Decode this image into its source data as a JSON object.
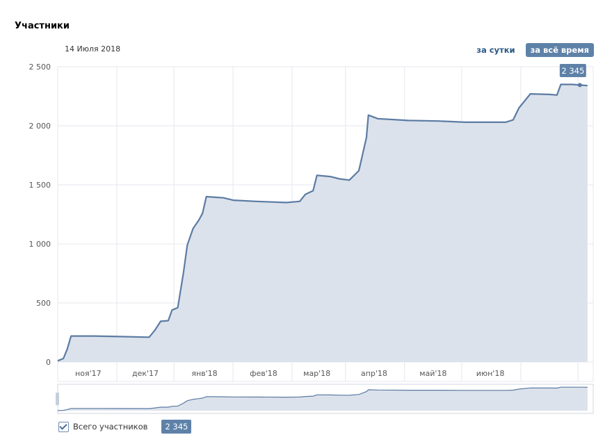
{
  "header": {
    "title": "Участники"
  },
  "hover_date": "14 Июля 2018",
  "range": {
    "day_label": "за сутки",
    "all_label": "за всё время",
    "active": "all"
  },
  "legend": {
    "label": "Всего участников",
    "value": "2 345",
    "checked": true
  },
  "colors": {
    "line": "#5b7ba3",
    "fill": "#dce2eb",
    "badge": "#5e81a8",
    "grid": "#e4e7ec"
  },
  "chart_data": {
    "type": "area",
    "title": "Участники",
    "xlabel": "",
    "ylabel": "",
    "ylim": [
      0,
      2500
    ],
    "y_ticks": [
      "0",
      "500",
      "1 000",
      "1 500",
      "2 000",
      "2 500"
    ],
    "x_ticks": [
      "ноя'17",
      "дек'17",
      "янв'18",
      "фев'18",
      "мар'18",
      "апр'18",
      "май'18",
      "июн'18"
    ],
    "x_domain": [
      "2017-10-13",
      "2017-07-21"
    ],
    "series": [
      {
        "name": "Всего участников",
        "points": [
          [
            "2017-10-13",
            10
          ],
          [
            "2017-10-16",
            30
          ],
          [
            "2017-10-18",
            110
          ],
          [
            "2017-10-20",
            220
          ],
          [
            "2017-11-01",
            220
          ],
          [
            "2017-11-15",
            215
          ],
          [
            "2017-11-30",
            210
          ],
          [
            "2017-12-03",
            270
          ],
          [
            "2017-12-06",
            345
          ],
          [
            "2017-12-10",
            350
          ],
          [
            "2017-12-12",
            440
          ],
          [
            "2017-12-15",
            460
          ],
          [
            "2017-12-18",
            760
          ],
          [
            "2017-12-20",
            990
          ],
          [
            "2017-12-23",
            1130
          ],
          [
            "2017-12-26",
            1200
          ],
          [
            "2017-12-28",
            1260
          ],
          [
            "2017-12-30",
            1400
          ],
          [
            "2018-01-08",
            1390
          ],
          [
            "2018-01-13",
            1370
          ],
          [
            "2018-01-25",
            1360
          ],
          [
            "2018-02-10",
            1350
          ],
          [
            "2018-02-17",
            1360
          ],
          [
            "2018-02-20",
            1420
          ],
          [
            "2018-02-24",
            1450
          ],
          [
            "2018-02-26",
            1580
          ],
          [
            "2018-03-05",
            1570
          ],
          [
            "2018-03-10",
            1550
          ],
          [
            "2018-03-15",
            1540
          ],
          [
            "2018-03-20",
            1620
          ],
          [
            "2018-03-24",
            1900
          ],
          [
            "2018-03-25",
            2090
          ],
          [
            "2018-03-30",
            2060
          ],
          [
            "2018-04-15",
            2045
          ],
          [
            "2018-05-01",
            2040
          ],
          [
            "2018-05-15",
            2030
          ],
          [
            "2018-06-05",
            2030
          ],
          [
            "2018-06-09",
            2050
          ],
          [
            "2018-06-12",
            2150
          ],
          [
            "2018-06-18",
            2270
          ],
          [
            "2018-06-28",
            2265
          ],
          [
            "2018-07-02",
            2260
          ],
          [
            "2018-07-04",
            2350
          ],
          [
            "2018-07-10",
            2350
          ],
          [
            "2018-07-14",
            2345
          ],
          [
            "2018-07-18",
            2340
          ]
        ]
      }
    ],
    "tooltip": {
      "date": "2018-07-14",
      "label": "2 345"
    }
  }
}
